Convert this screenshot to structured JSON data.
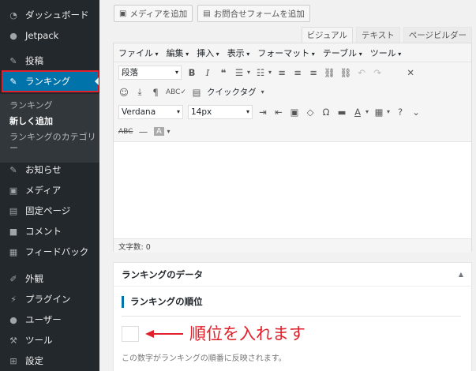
{
  "sidebar": {
    "top_items": [
      {
        "label": "ダッシュボード",
        "icon": "dashboard-icon"
      },
      {
        "label": "Jetpack",
        "icon": "jetpack-icon"
      },
      {
        "label": "投稿",
        "icon": "pin-icon"
      }
    ],
    "active_item": {
      "label": "ランキング",
      "icon": "pin-icon"
    },
    "submenu": [
      "ランキング",
      "新しく追加",
      "ランキングのカテゴリー"
    ],
    "bottom_items": [
      {
        "label": "お知らせ",
        "icon": "pin-icon"
      },
      {
        "label": "メディア",
        "icon": "media-icon"
      },
      {
        "label": "固定ページ",
        "icon": "page-icon"
      },
      {
        "label": "コメント",
        "icon": "comment-icon"
      },
      {
        "label": "フィードバック",
        "icon": "feedback-icon"
      },
      {
        "label": "外観",
        "icon": "appearance-icon"
      },
      {
        "label": "プラグイン",
        "icon": "plugin-icon"
      },
      {
        "label": "ユーザー",
        "icon": "user-icon"
      },
      {
        "label": "ツール",
        "icon": "tool-icon"
      },
      {
        "label": "設定",
        "icon": "settings-icon"
      }
    ]
  },
  "media": {
    "add_media": "メディアを追加",
    "add_form": "お問合せフォームを追加"
  },
  "editor_tabs": [
    "ビジュアル",
    "テキスト",
    "ページビルダー"
  ],
  "menubar": [
    "ファイル",
    "編集",
    "挿入",
    "表示",
    "フォーマット",
    "テーブル",
    "ツール"
  ],
  "toolbar": {
    "format_select": "段落",
    "quicktag": "クイックタグ",
    "font_family": "Verdana",
    "font_size": "14px",
    "abc": "ABC",
    "text_color": "A",
    "bg_color": "A"
  },
  "status": {
    "word_count": "文字数: 0"
  },
  "metabox": {
    "title": "ランキングのデータ",
    "field_label": "ランキングの順位",
    "annotation": "順位を入れます",
    "hint": "この数字がランキングの順番に反映されます。"
  },
  "colors": {
    "sidebar_bg": "#23282d",
    "active_bg": "#0073aa",
    "annotation_red": "#e0202a"
  }
}
